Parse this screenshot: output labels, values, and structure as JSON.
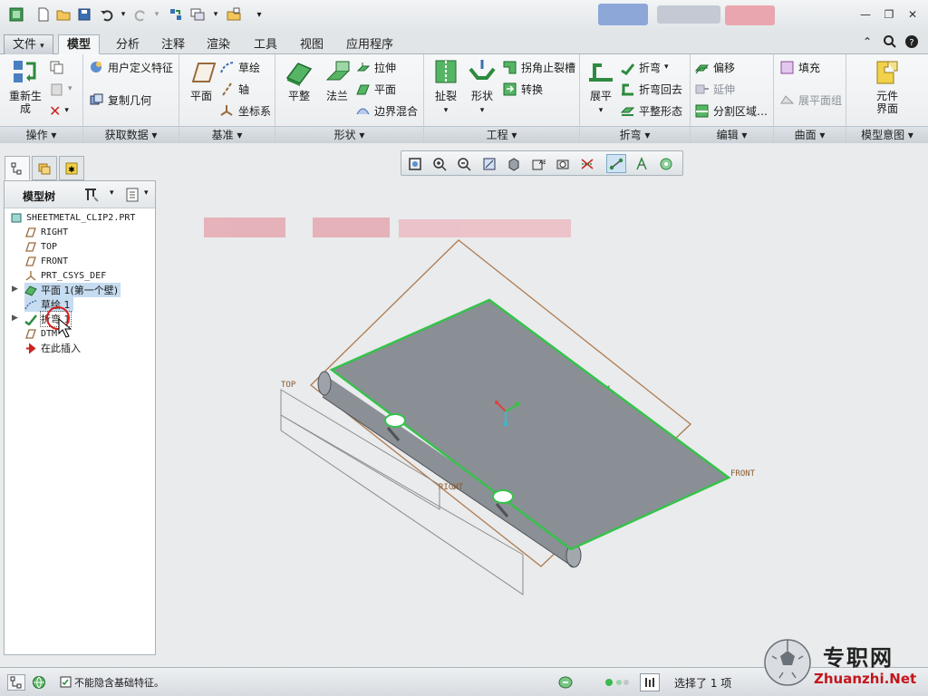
{
  "tabs": {
    "file": "文件",
    "items": [
      "模型",
      "分析",
      "注释",
      "渲染",
      "工具",
      "视图",
      "应用程序"
    ],
    "active": "模型"
  },
  "ribbon": {
    "operations": {
      "label": "操作",
      "regen": "重新生\n成"
    },
    "get_data": {
      "label": "获取数据",
      "udf": "用户定义特征",
      "copy_geom": "复制几何"
    },
    "datum": {
      "label": "基准",
      "plane": "平面",
      "sketch": "草绘",
      "axis": "轴",
      "csys": "坐标系"
    },
    "shapes": {
      "label": "形状",
      "flat": "平整",
      "flange": "法兰",
      "extrude": "拉伸",
      "plane": "平面",
      "blend": "边界混合"
    },
    "engineering": {
      "label": "工程",
      "rip": "扯裂",
      "form": "形状",
      "corner_relief": "拐角止裂槽",
      "convert": "转换"
    },
    "bends": {
      "label": "折弯",
      "unbend": "展平",
      "bend": "折弯",
      "bend_back": "折弯回去",
      "flatten": "平整形态"
    },
    "editing": {
      "label": "编辑",
      "offset": "偏移",
      "extend": "延伸",
      "split": "分割区域…"
    },
    "surfaces": {
      "label": "曲面",
      "fill": "填充",
      "flat_pattern": "展平面组"
    },
    "intent": {
      "label": "模型意图",
      "component": "元件\n界面"
    }
  },
  "tree": {
    "title": "模型树",
    "root": "SHEETMETAL_CLIP2.PRT",
    "items": [
      {
        "label": "RIGHT",
        "icon": "datum-plane-icon"
      },
      {
        "label": "TOP",
        "icon": "datum-plane-icon"
      },
      {
        "label": "FRONT",
        "icon": "datum-plane-icon"
      },
      {
        "label": "PRT_CSYS_DEF",
        "icon": "csys-icon"
      },
      {
        "label": "平面 1(第一个壁)",
        "icon": "flat-wall-icon"
      },
      {
        "label": "草绘 1",
        "icon": "sketch-icon"
      },
      {
        "label": "折弯 1",
        "icon": "bend-icon"
      },
      {
        "label": "DTM",
        "icon": "datum-plane-icon"
      },
      {
        "label": "在此插入",
        "icon": "insert-arrow-icon"
      }
    ]
  },
  "model_labels": {
    "top": "TOP",
    "right": "RIGHT",
    "front": "FRONT"
  },
  "status": {
    "message": "不能隐含基础特征。",
    "selected": "选择了 1 项"
  },
  "logo": {
    "cn": "专职网",
    "url": "Zhuanzhi.Net"
  },
  "colors": {
    "accent": "#2d8a3e",
    "selection_green": "#35c24a",
    "datum_brown": "#b07a4e"
  }
}
